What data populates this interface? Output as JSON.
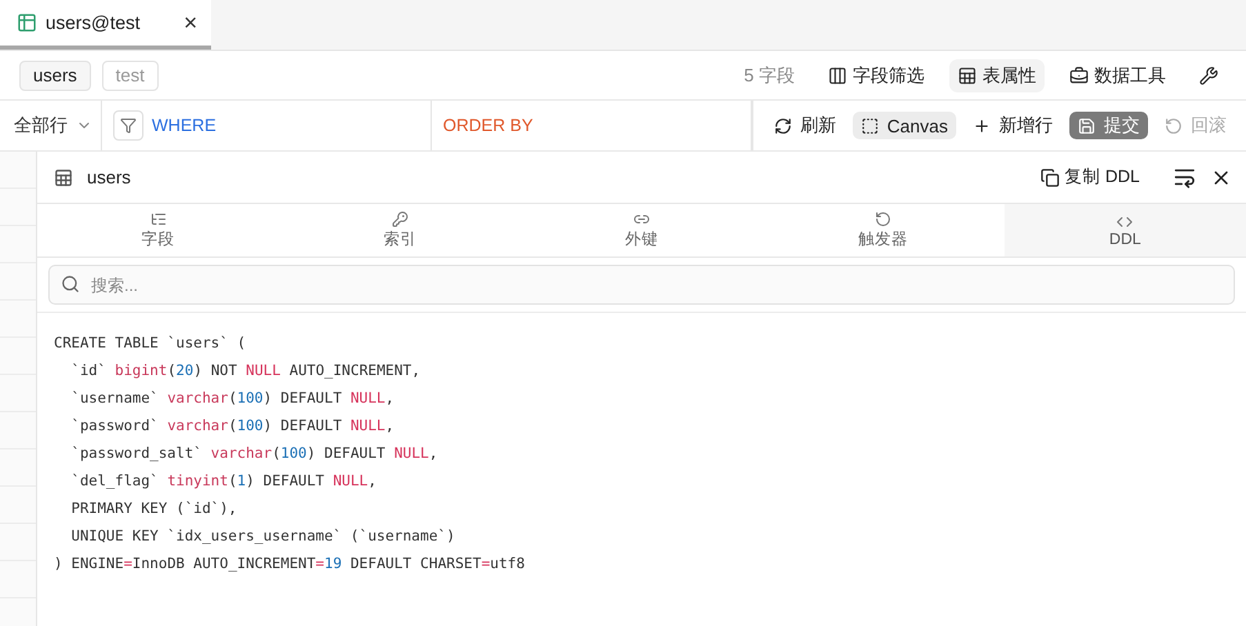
{
  "tabs": [
    {
      "label": "users@test",
      "selected": true,
      "close": "×"
    }
  ],
  "chips": [
    {
      "label": "users",
      "selected": true
    },
    {
      "label": "test",
      "selected": false
    }
  ],
  "field_count": "5 字段",
  "top_actions": [
    {
      "label": "字段筛选",
      "selected": false
    },
    {
      "label": "表属性",
      "selected": true
    },
    {
      "label": "数据工具",
      "selected": false
    },
    {
      "selected": false
    }
  ],
  "row_filter": {
    "label": "全部行"
  },
  "where": {
    "placeholder": "WHERE"
  },
  "order_by": {
    "placeholder": "ORDER BY"
  },
  "toolbar": [
    {
      "kind": "plain",
      "label": "刷新",
      "disabled": false
    },
    {
      "kind": "chip",
      "label": "Canvas",
      "disabled": false
    },
    {
      "kind": "plain",
      "label": "新增行",
      "disabled": false
    },
    {
      "kind": "dark",
      "label": "提交",
      "disabled": false
    },
    {
      "kind": "plain",
      "label": "回滚",
      "disabled": true
    }
  ],
  "panel": {
    "title": "users",
    "copy_label": "复制 DDL",
    "tabs": [
      {
        "label": "字段",
        "selected": false
      },
      {
        "label": "索引",
        "selected": false
      },
      {
        "label": "外键",
        "selected": false
      },
      {
        "label": "触发器",
        "selected": false
      },
      {
        "label": "DDL",
        "selected": true
      }
    ],
    "search": {
      "placeholder": "搜索..."
    },
    "code": [
      [
        {
          "kind": "plain",
          "text": "CREATE TABLE `users` ("
        }
      ],
      [
        {
          "kind": "plain",
          "text": "  `id` "
        },
        {
          "kind": "type",
          "text": "bigint"
        },
        {
          "kind": "plain",
          "text": "("
        },
        {
          "kind": "number",
          "text": "20"
        },
        {
          "kind": "plain",
          "text": ") NOT "
        },
        {
          "kind": "keyword",
          "text": "NULL"
        },
        {
          "kind": "plain",
          "text": " AUTO_INCREMENT,"
        }
      ],
      [
        {
          "kind": "plain",
          "text": "  `username` "
        },
        {
          "kind": "type",
          "text": "varchar"
        },
        {
          "kind": "plain",
          "text": "("
        },
        {
          "kind": "number",
          "text": "100"
        },
        {
          "kind": "plain",
          "text": ") DEFAULT "
        },
        {
          "kind": "keyword",
          "text": "NULL"
        },
        {
          "kind": "plain",
          "text": ","
        }
      ],
      [
        {
          "kind": "plain",
          "text": "  `password` "
        },
        {
          "kind": "type",
          "text": "varchar"
        },
        {
          "kind": "plain",
          "text": "("
        },
        {
          "kind": "number",
          "text": "100"
        },
        {
          "kind": "plain",
          "text": ") DEFAULT "
        },
        {
          "kind": "keyword",
          "text": "NULL"
        },
        {
          "kind": "plain",
          "text": ","
        }
      ],
      [
        {
          "kind": "plain",
          "text": "  `password_salt` "
        },
        {
          "kind": "type",
          "text": "varchar"
        },
        {
          "kind": "plain",
          "text": "("
        },
        {
          "kind": "number",
          "text": "100"
        },
        {
          "kind": "plain",
          "text": ") DEFAULT "
        },
        {
          "kind": "keyword",
          "text": "NULL"
        },
        {
          "kind": "plain",
          "text": ","
        }
      ],
      [
        {
          "kind": "plain",
          "text": "  `del_flag` "
        },
        {
          "kind": "type",
          "text": "tinyint"
        },
        {
          "kind": "plain",
          "text": "("
        },
        {
          "kind": "number",
          "text": "1"
        },
        {
          "kind": "plain",
          "text": ") DEFAULT "
        },
        {
          "kind": "keyword",
          "text": "NULL"
        },
        {
          "kind": "plain",
          "text": ","
        }
      ],
      [
        {
          "kind": "plain",
          "text": "  PRIMARY KEY (`id`),"
        }
      ],
      [
        {
          "kind": "plain",
          "text": "  UNIQUE KEY `idx_users_username` (`username`)"
        }
      ],
      [
        {
          "kind": "plain",
          "text": ") ENGINE"
        },
        {
          "kind": "keyword",
          "text": "="
        },
        {
          "kind": "plain",
          "text": "InnoDB AUTO_INCREMENT"
        },
        {
          "kind": "keyword",
          "text": "="
        },
        {
          "kind": "number",
          "text": "19"
        },
        {
          "kind": "plain",
          "text": " DEFAULT CHARSET"
        },
        {
          "kind": "keyword",
          "text": "="
        },
        {
          "kind": "plain",
          "text": "utf8"
        }
      ]
    ]
  }
}
